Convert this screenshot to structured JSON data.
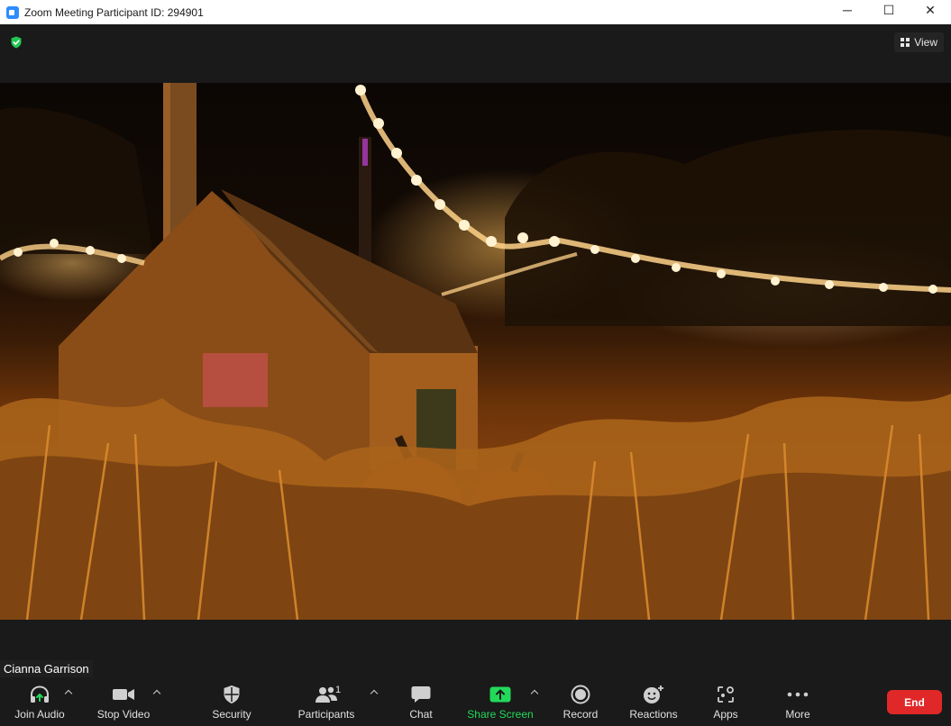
{
  "window": {
    "title": "Zoom Meeting Participant ID: 294901",
    "controls": {
      "minimize": "─",
      "maximize": "☐",
      "close": "✕"
    }
  },
  "top": {
    "view_label": "View",
    "security_icon": "shield-check-icon"
  },
  "participant": {
    "name": "Cianna Garrison"
  },
  "toolbar": {
    "join_audio": "Join Audio",
    "stop_video": "Stop Video",
    "security": "Security",
    "participants": "Participants",
    "participants_count": "1",
    "chat": "Chat",
    "share_screen": "Share Screen",
    "record": "Record",
    "reactions": "Reactions",
    "apps": "Apps",
    "more": "More",
    "end": "End"
  },
  "colors": {
    "share_green": "#23d959",
    "end_red": "#e02828",
    "shield_green": "#23c552",
    "toolbar_bg": "#1a1a1a"
  }
}
